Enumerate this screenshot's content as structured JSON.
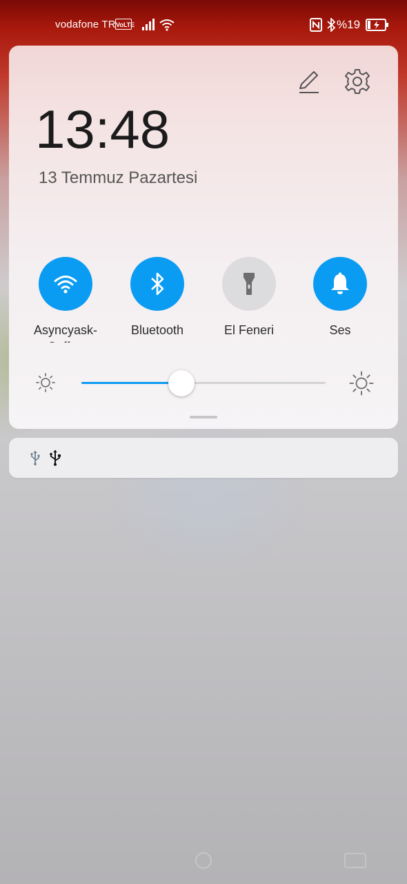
{
  "status_bar": {
    "carrier": "vodafone TR",
    "volte_badge": "VoLTE",
    "battery_percent": "%19",
    "icons": [
      "signal-icon",
      "wifi-icon",
      "nfc-icon",
      "bluetooth-icon",
      "battery-charging-icon"
    ]
  },
  "panel": {
    "time": "13:48",
    "date": "13 Temmuz Pazartesi",
    "tiles": [
      {
        "label": "Asyncyask-Coffee",
        "icon": "wifi-icon",
        "active": true
      },
      {
        "label": "Bluetooth",
        "icon": "bluetooth-icon",
        "active": true
      },
      {
        "label": "El Feneri",
        "icon": "flashlight-icon",
        "active": false
      },
      {
        "label": "Ses",
        "icon": "bell-icon",
        "active": true
      }
    ],
    "brightness_level": 0.41
  },
  "notification": {
    "icons": [
      "usb-icon",
      "usb-debug-icon"
    ]
  },
  "colors": {
    "accent": "#0a9bf2",
    "tile_off": "#dcdbdd"
  }
}
